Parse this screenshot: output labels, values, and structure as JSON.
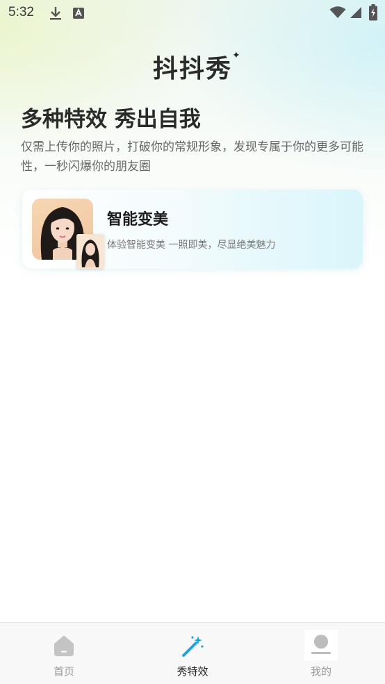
{
  "status_bar": {
    "time": "5:32",
    "left_icons": [
      "download-icon",
      "keyboard-a-icon"
    ],
    "right_icons": [
      "wifi-icon",
      "signal-icon",
      "battery-charging-icon"
    ]
  },
  "header": {
    "title": "抖抖秀",
    "decoration_icon": "sparkle-icon"
  },
  "hero": {
    "headline": "多种特效 秀出自我",
    "subtitle": "仅需上传你的照片，打破你的常规形象，发现专属于你的更多可能性，一秒闪爆你的朋友圈"
  },
  "feature_card": {
    "title": "智能变美",
    "description": "体验智能变美 一照即美，尽显绝美魅力",
    "image": "portrait-photo",
    "thumbnail": "portrait-thumbnail"
  },
  "tab_bar": {
    "tabs": [
      {
        "label": "首页",
        "icon": "home-icon",
        "active": false
      },
      {
        "label": "秀特效",
        "icon": "magic-wand-icon",
        "active": true
      },
      {
        "label": "我的",
        "icon": "user-icon",
        "active": false
      }
    ]
  },
  "colors": {
    "accent": "#1aa7d6",
    "inactive_tab": "#9a9a9a",
    "active_tab": "#222222"
  }
}
